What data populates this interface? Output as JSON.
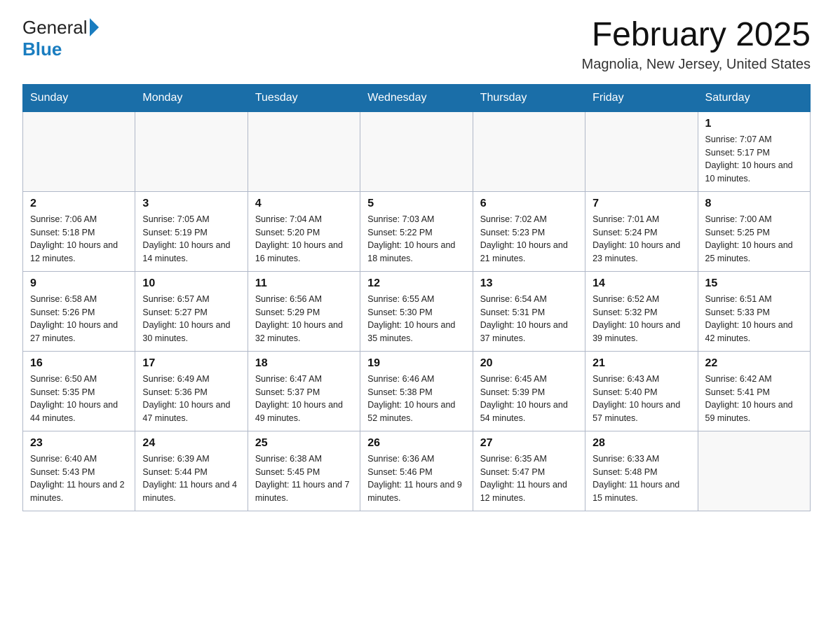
{
  "header": {
    "logo_general": "General",
    "logo_blue": "Blue",
    "title": "February 2025",
    "location": "Magnolia, New Jersey, United States"
  },
  "days_of_week": [
    "Sunday",
    "Monday",
    "Tuesday",
    "Wednesday",
    "Thursday",
    "Friday",
    "Saturday"
  ],
  "weeks": [
    [
      {
        "day": "",
        "info": ""
      },
      {
        "day": "",
        "info": ""
      },
      {
        "day": "",
        "info": ""
      },
      {
        "day": "",
        "info": ""
      },
      {
        "day": "",
        "info": ""
      },
      {
        "day": "",
        "info": ""
      },
      {
        "day": "1",
        "info": "Sunrise: 7:07 AM\nSunset: 5:17 PM\nDaylight: 10 hours and 10 minutes."
      }
    ],
    [
      {
        "day": "2",
        "info": "Sunrise: 7:06 AM\nSunset: 5:18 PM\nDaylight: 10 hours and 12 minutes."
      },
      {
        "day": "3",
        "info": "Sunrise: 7:05 AM\nSunset: 5:19 PM\nDaylight: 10 hours and 14 minutes."
      },
      {
        "day": "4",
        "info": "Sunrise: 7:04 AM\nSunset: 5:20 PM\nDaylight: 10 hours and 16 minutes."
      },
      {
        "day": "5",
        "info": "Sunrise: 7:03 AM\nSunset: 5:22 PM\nDaylight: 10 hours and 18 minutes."
      },
      {
        "day": "6",
        "info": "Sunrise: 7:02 AM\nSunset: 5:23 PM\nDaylight: 10 hours and 21 minutes."
      },
      {
        "day": "7",
        "info": "Sunrise: 7:01 AM\nSunset: 5:24 PM\nDaylight: 10 hours and 23 minutes."
      },
      {
        "day": "8",
        "info": "Sunrise: 7:00 AM\nSunset: 5:25 PM\nDaylight: 10 hours and 25 minutes."
      }
    ],
    [
      {
        "day": "9",
        "info": "Sunrise: 6:58 AM\nSunset: 5:26 PM\nDaylight: 10 hours and 27 minutes."
      },
      {
        "day": "10",
        "info": "Sunrise: 6:57 AM\nSunset: 5:27 PM\nDaylight: 10 hours and 30 minutes."
      },
      {
        "day": "11",
        "info": "Sunrise: 6:56 AM\nSunset: 5:29 PM\nDaylight: 10 hours and 32 minutes."
      },
      {
        "day": "12",
        "info": "Sunrise: 6:55 AM\nSunset: 5:30 PM\nDaylight: 10 hours and 35 minutes."
      },
      {
        "day": "13",
        "info": "Sunrise: 6:54 AM\nSunset: 5:31 PM\nDaylight: 10 hours and 37 minutes."
      },
      {
        "day": "14",
        "info": "Sunrise: 6:52 AM\nSunset: 5:32 PM\nDaylight: 10 hours and 39 minutes."
      },
      {
        "day": "15",
        "info": "Sunrise: 6:51 AM\nSunset: 5:33 PM\nDaylight: 10 hours and 42 minutes."
      }
    ],
    [
      {
        "day": "16",
        "info": "Sunrise: 6:50 AM\nSunset: 5:35 PM\nDaylight: 10 hours and 44 minutes."
      },
      {
        "day": "17",
        "info": "Sunrise: 6:49 AM\nSunset: 5:36 PM\nDaylight: 10 hours and 47 minutes."
      },
      {
        "day": "18",
        "info": "Sunrise: 6:47 AM\nSunset: 5:37 PM\nDaylight: 10 hours and 49 minutes."
      },
      {
        "day": "19",
        "info": "Sunrise: 6:46 AM\nSunset: 5:38 PM\nDaylight: 10 hours and 52 minutes."
      },
      {
        "day": "20",
        "info": "Sunrise: 6:45 AM\nSunset: 5:39 PM\nDaylight: 10 hours and 54 minutes."
      },
      {
        "day": "21",
        "info": "Sunrise: 6:43 AM\nSunset: 5:40 PM\nDaylight: 10 hours and 57 minutes."
      },
      {
        "day": "22",
        "info": "Sunrise: 6:42 AM\nSunset: 5:41 PM\nDaylight: 10 hours and 59 minutes."
      }
    ],
    [
      {
        "day": "23",
        "info": "Sunrise: 6:40 AM\nSunset: 5:43 PM\nDaylight: 11 hours and 2 minutes."
      },
      {
        "day": "24",
        "info": "Sunrise: 6:39 AM\nSunset: 5:44 PM\nDaylight: 11 hours and 4 minutes."
      },
      {
        "day": "25",
        "info": "Sunrise: 6:38 AM\nSunset: 5:45 PM\nDaylight: 11 hours and 7 minutes."
      },
      {
        "day": "26",
        "info": "Sunrise: 6:36 AM\nSunset: 5:46 PM\nDaylight: 11 hours and 9 minutes."
      },
      {
        "day": "27",
        "info": "Sunrise: 6:35 AM\nSunset: 5:47 PM\nDaylight: 11 hours and 12 minutes."
      },
      {
        "day": "28",
        "info": "Sunrise: 6:33 AM\nSunset: 5:48 PM\nDaylight: 11 hours and 15 minutes."
      },
      {
        "day": "",
        "info": ""
      }
    ]
  ]
}
